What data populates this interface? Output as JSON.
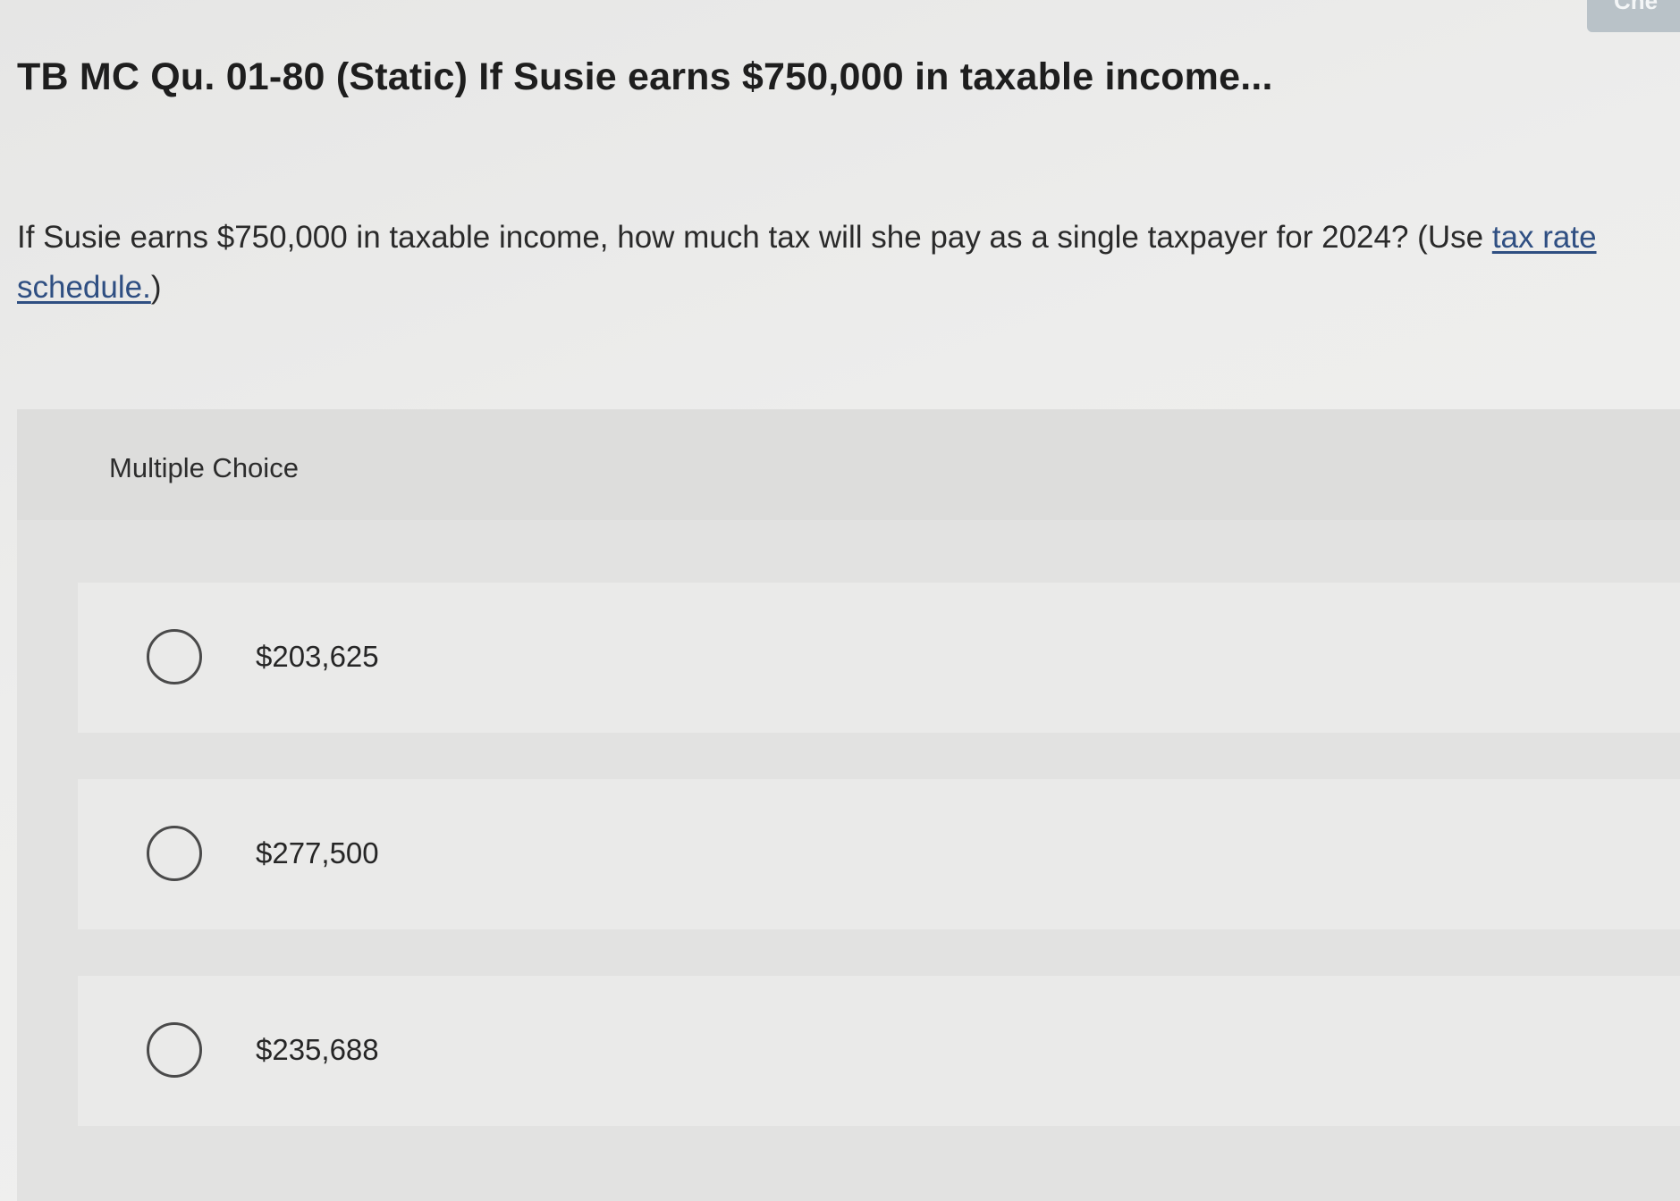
{
  "corner_button": {
    "label": "Che"
  },
  "title": "TB MC Qu. 01-80 (Static) If Susie earns $750,000 in taxable income...",
  "question": {
    "text": "If Susie earns $750,000 in taxable income, how much tax will she pay as a single taxpayer for 2024? (Use ",
    "link_text": "tax rate schedule.",
    "suffix": ")"
  },
  "multiple_choice": {
    "label": "Multiple Choice",
    "options": [
      {
        "label": "$203,625"
      },
      {
        "label": "$277,500"
      },
      {
        "label": "$235,688"
      }
    ]
  }
}
